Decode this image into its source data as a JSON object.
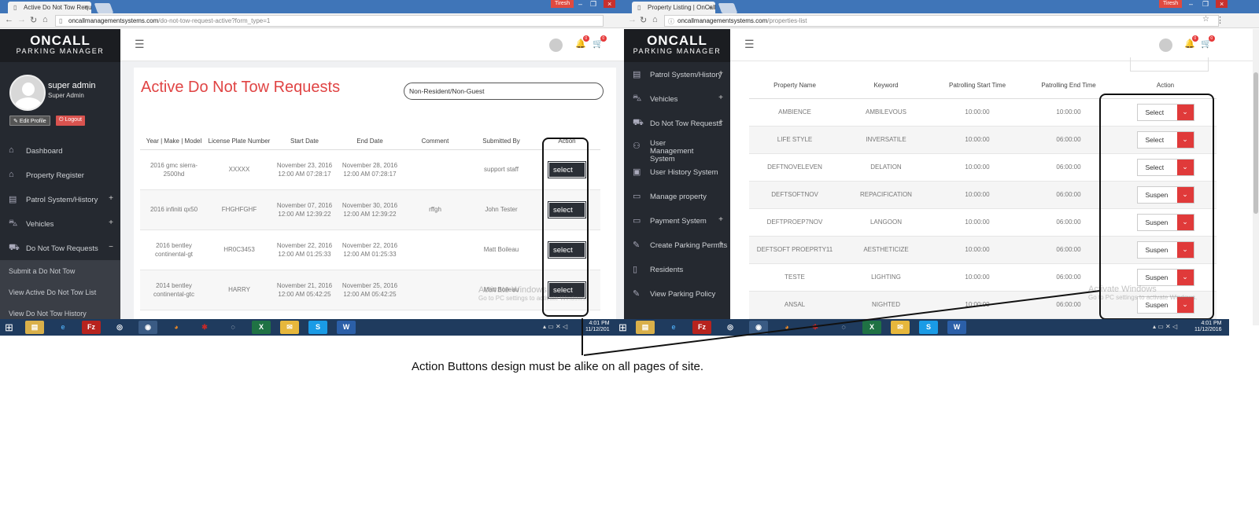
{
  "left": {
    "tab_title": "Active Do Not Tow Requ",
    "user_tag": "Tiresh",
    "url_host": "oncallmanagementsystems.com",
    "url_path": "/do-not-tow-request-active?form_type=1",
    "logo_line1": "ONCALL",
    "logo_line2": "PARKING MANAGER",
    "user_name": "super admin",
    "user_role": "Super Admin",
    "edit_profile": "Edit Profile",
    "logout": "Logout",
    "menu": [
      {
        "label": "Dashboard",
        "icon": "home-icon",
        "expand": ""
      },
      {
        "label": "Property Register",
        "icon": "home-icon",
        "expand": ""
      },
      {
        "label": "Patrol System/History",
        "icon": "clipboard-icon",
        "expand": "+"
      },
      {
        "label": "Vehicles",
        "icon": "car-icon",
        "expand": "+"
      },
      {
        "label": "Do Not Tow Requests",
        "icon": "tow-truck-icon",
        "expand": "−"
      }
    ],
    "submenu": [
      "Submit a Do Not Tow",
      "View Active Do Not Tow List",
      "View Do Not Tow History"
    ],
    "page_title": "Active Do Not Tow Requests",
    "filter_value": "Non-Resident/Non-Guest",
    "columns": [
      "Year | Make | Model",
      "License Plate Number",
      "Start Date",
      "End Date",
      "Comment",
      "Submitted By",
      "Action"
    ],
    "rows": [
      {
        "vehicle": "2016 gmc sierra-2500hd",
        "plate": "XXXXX",
        "start": "November 23, 2016 12:00 AM 07:28:17",
        "end": "November 28, 2016 12:00 AM 07:28:17",
        "comment": "",
        "by": "support staff",
        "action": "select"
      },
      {
        "vehicle": "2016 infiniti qx50",
        "plate": "FHGHFGHF",
        "start": "November 07, 2016 12:00 AM 12:39:22",
        "end": "November 30, 2016 12:00 AM 12:39:22",
        "comment": "rffgh",
        "by": "John Tester",
        "action": "select"
      },
      {
        "vehicle": "2016 bentley continental-gt",
        "plate": "HR0C3453",
        "start": "November 22, 2016 12:00 AM 01:25:33",
        "end": "November 22, 2016 12:00 AM 01:25:33",
        "comment": "",
        "by": "Matt Boileau",
        "action": "select"
      },
      {
        "vehicle": "2014 bentley continental-gtc",
        "plate": "HARRY",
        "start": "November 21, 2016 12:00 AM 05:42:25",
        "end": "November 25, 2016 12:00 AM 05:42:25",
        "comment": "",
        "by": "Matt Boileau",
        "action": "select"
      }
    ],
    "watermark1": "Activate Windows",
    "watermark2": "Go to PC settings to activate Windows.",
    "clock_time": "4:01 PM",
    "clock_date": "11/12/201"
  },
  "right": {
    "tab_title": "Property Listing | OnCall",
    "user_tag": "Tiresh",
    "url_host": "oncallmanagementsystems.com",
    "url_path": "/properties-list",
    "logo_line1": "ONCALL",
    "logo_line2": "PARKING MANAGER",
    "menu": [
      {
        "label": "Patrol System/History",
        "icon": "clipboard-icon",
        "expand": "+"
      },
      {
        "label": "Vehicles",
        "icon": "car-icon",
        "expand": "+"
      },
      {
        "label": "Do Not Tow Requests",
        "icon": "tow-truck-icon",
        "expand": "+"
      },
      {
        "label": "User Management System",
        "icon": "users-icon",
        "expand": ""
      },
      {
        "label": "User History System",
        "icon": "id-card-icon",
        "expand": ""
      },
      {
        "label": "Manage property",
        "icon": "monitor-icon",
        "expand": ""
      },
      {
        "label": "Payment System",
        "icon": "monitor-icon",
        "expand": "+"
      },
      {
        "label": "Create Parking Permits",
        "icon": "edit-icon",
        "expand": "+"
      },
      {
        "label": "Residents",
        "icon": "document-icon",
        "expand": ""
      },
      {
        "label": "View Parking Policy",
        "icon": "edit-icon",
        "expand": ""
      }
    ],
    "columns": [
      "Property Name",
      "Keyword",
      "Patrolling Start Time",
      "Patrolling End Time",
      "Action"
    ],
    "rows": [
      {
        "name": "AMBIENCE",
        "keyword": "AMBILEVOUS",
        "start": "10:00:00",
        "end": "10:00:00",
        "action": "Select"
      },
      {
        "name": "LIFE STYLE",
        "keyword": "INVERSATILE",
        "start": "10:00:00",
        "end": "06:00:00",
        "action": "Select"
      },
      {
        "name": "DEFTNOVELEVEN",
        "keyword": "DELATION",
        "start": "10:00:00",
        "end": "06:00:00",
        "action": "Select"
      },
      {
        "name": "DEFTSOFTNOV",
        "keyword": "REPACIFICATION",
        "start": "10:00:00",
        "end": "06:00:00",
        "action": "Suspen"
      },
      {
        "name": "DEFTPROEP7NOV",
        "keyword": "LANGOON",
        "start": "10:00:00",
        "end": "06:00:00",
        "action": "Suspen"
      },
      {
        "name": "DEFTSOFT PROEPRTY11",
        "keyword": "AESTHETICIZE",
        "start": "10:00:00",
        "end": "06:00:00",
        "action": "Suspen"
      },
      {
        "name": "TESTE",
        "keyword": "LIGHTING",
        "start": "10:00:00",
        "end": "06:00:00",
        "action": "Suspen"
      },
      {
        "name": "ANSAL",
        "keyword": "NIGHTED",
        "start": "10:00:00",
        "end": "06:00:00",
        "action": "Suspen"
      }
    ],
    "watermark1": "Activate Windows",
    "watermark2": "Go to PC settings to activate Windows.",
    "clock_time": "4:01 PM",
    "clock_date": "11/12/2016"
  },
  "annotation": "Action Buttons design must be alike on all pages of site.",
  "colors": {
    "accent_red": "#e04444",
    "sidebar": "#252930",
    "select_dark": "#2b2f36",
    "chrome_blue": "#3f75b8"
  }
}
